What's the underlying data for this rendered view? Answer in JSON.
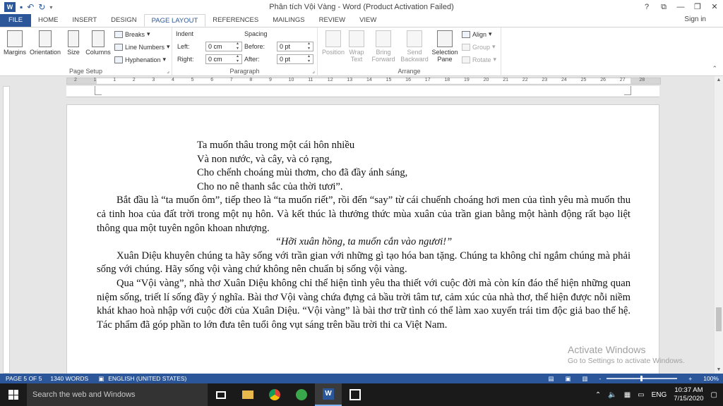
{
  "window": {
    "title": "Phân tích Vội Vàng - Word (Product Activation Failed)",
    "help": "?",
    "signin": "Sign in"
  },
  "tabs": [
    "FILE",
    "HOME",
    "INSERT",
    "DESIGN",
    "PAGE LAYOUT",
    "REFERENCES",
    "MAILINGS",
    "REVIEW",
    "VIEW"
  ],
  "ribbon": {
    "page_setup": {
      "label": "Page Setup",
      "margins": "Margins",
      "orientation": "Orientation",
      "size": "Size",
      "columns": "Columns",
      "breaks": "Breaks",
      "line_numbers": "Line Numbers",
      "hyphenation": "Hyphenation"
    },
    "paragraph": {
      "label": "Paragraph",
      "indent": "Indent",
      "spacing": "Spacing",
      "left_label": "Left:",
      "left_value": "0 cm",
      "right_label": "Right:",
      "right_value": "0 cm",
      "before_label": "Before:",
      "before_value": "0 pt",
      "after_label": "After:",
      "after_value": "0 pt"
    },
    "arrange": {
      "label": "Arrange",
      "position": "Position",
      "wrap_text_1": "Wrap",
      "wrap_text_2": "Text",
      "bring_forward_1": "Bring",
      "bring_forward_2": "Forward",
      "send_backward_1": "Send",
      "send_backward_2": "Backward",
      "selection_pane_1": "Selection",
      "selection_pane_2": "Pane",
      "align": "Align",
      "group": "Group",
      "rotate": "Rotate"
    }
  },
  "ruler_numbers": [
    "2",
    "1",
    "1",
    "2",
    "3",
    "4",
    "5",
    "6",
    "7",
    "8",
    "9",
    "10",
    "11",
    "12",
    "13",
    "14",
    "15",
    "16",
    "17",
    "18",
    "19",
    "20",
    "21",
    "22",
    "23",
    "24",
    "25",
    "26",
    "27",
    "28"
  ],
  "document": {
    "verse": [
      "Ta muốn thâu trong một cái hôn nhiều",
      "Và non nước, và cây, và cỏ rạng,",
      "Cho chếnh choáng mùi thơm, cho đã đầy ánh sáng,",
      "Cho no nê thanh sắc của thời tươi”."
    ],
    "para1": "Bắt đầu là “ta muốn ôm”, tiếp theo là “ta muốn riết”, rồi đến “say” từ cái chuếnh choáng hơi men của tình yêu mà muốn thu cả tinh hoa của đất trời trong một nụ hôn. Và kết thúc là thưởng thức mùa xuân của trần gian bằng một hành động rất bạo liệt thông qua một tuyên ngôn khoan nhượng.",
    "quote": "“Hỡi xuân hồng, ta muốn cắn vào ngươi!”",
    "para2": "Xuân Diệu khuyên chúng ta hãy sống với trần gian với những gì tạo hóa ban tặng. Chúng ta không chỉ ngắm chúng mà phải sống với chúng. Hãy sống vội vàng chứ không nên chuẩn bị sống vội vàng.",
    "para3": "Qua “Vội vàng”, nhà thơ Xuân Diệu không chỉ thể hiện tình yêu tha thiết với cuộc đời mà còn kín đáo thể hiện những quan niệm sống, triết lí sống đầy ý nghĩa. Bài thơ Vội vàng chứa đựng cả bầu trời tâm tư, cảm xúc của nhà thơ, thể hiện được nỗi niềm khát khao hoà nhập với cuộc đời của Xuân Diệu. “Vội vàng” là bài thơ trữ tình có thể làm xao xuyến trái tim độc giả bao thế hệ. Tác phẩm đã góp phần to lớn đưa tên tuổi ông vụt sáng trên bầu trời thi ca Việt Nam."
  },
  "watermark": {
    "title": "Activate Windows",
    "subtitle": "Go to Settings to activate Windows."
  },
  "statusbar": {
    "page": "PAGE 5 OF 5",
    "words": "1340 WORDS",
    "language": "ENGLISH (UNITED STATES)",
    "zoom_minus": "-",
    "zoom_plus": "+",
    "zoom": "100%"
  },
  "taskbar": {
    "search_placeholder": "Search the web and Windows",
    "language": "ENG",
    "time": "10:37 AM",
    "date": "7/15/2020"
  },
  "colors": {
    "word_blue": "#2b579a",
    "taskbar": "#1a1a1a"
  }
}
